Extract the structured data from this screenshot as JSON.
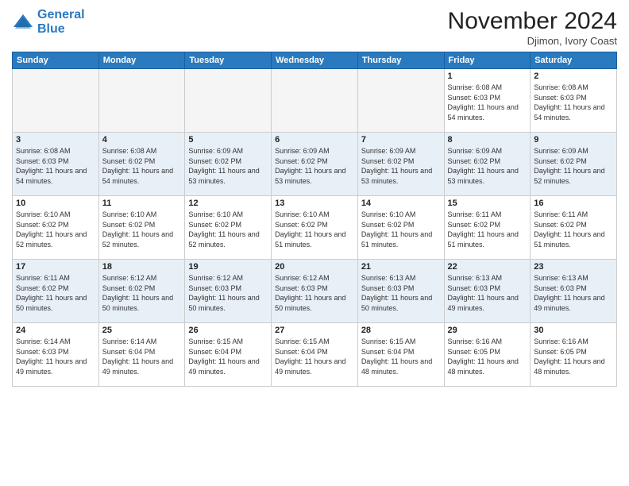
{
  "header": {
    "logo_line1": "General",
    "logo_line2": "Blue",
    "month_title": "November 2024",
    "location": "Djimon, Ivory Coast"
  },
  "weekdays": [
    "Sunday",
    "Monday",
    "Tuesday",
    "Wednesday",
    "Thursday",
    "Friday",
    "Saturday"
  ],
  "weeks": [
    [
      {
        "day": "",
        "empty": true
      },
      {
        "day": "",
        "empty": true
      },
      {
        "day": "",
        "empty": true
      },
      {
        "day": "",
        "empty": true
      },
      {
        "day": "",
        "empty": true
      },
      {
        "day": "1",
        "sunrise": "6:08 AM",
        "sunset": "6:03 PM",
        "daylight": "11 hours and 54 minutes."
      },
      {
        "day": "2",
        "sunrise": "6:08 AM",
        "sunset": "6:03 PM",
        "daylight": "11 hours and 54 minutes."
      }
    ],
    [
      {
        "day": "3",
        "sunrise": "6:08 AM",
        "sunset": "6:03 PM",
        "daylight": "11 hours and 54 minutes."
      },
      {
        "day": "4",
        "sunrise": "6:08 AM",
        "sunset": "6:02 PM",
        "daylight": "11 hours and 54 minutes."
      },
      {
        "day": "5",
        "sunrise": "6:09 AM",
        "sunset": "6:02 PM",
        "daylight": "11 hours and 53 minutes."
      },
      {
        "day": "6",
        "sunrise": "6:09 AM",
        "sunset": "6:02 PM",
        "daylight": "11 hours and 53 minutes."
      },
      {
        "day": "7",
        "sunrise": "6:09 AM",
        "sunset": "6:02 PM",
        "daylight": "11 hours and 53 minutes."
      },
      {
        "day": "8",
        "sunrise": "6:09 AM",
        "sunset": "6:02 PM",
        "daylight": "11 hours and 53 minutes."
      },
      {
        "day": "9",
        "sunrise": "6:09 AM",
        "sunset": "6:02 PM",
        "daylight": "11 hours and 52 minutes."
      }
    ],
    [
      {
        "day": "10",
        "sunrise": "6:10 AM",
        "sunset": "6:02 PM",
        "daylight": "11 hours and 52 minutes."
      },
      {
        "day": "11",
        "sunrise": "6:10 AM",
        "sunset": "6:02 PM",
        "daylight": "11 hours and 52 minutes."
      },
      {
        "day": "12",
        "sunrise": "6:10 AM",
        "sunset": "6:02 PM",
        "daylight": "11 hours and 52 minutes."
      },
      {
        "day": "13",
        "sunrise": "6:10 AM",
        "sunset": "6:02 PM",
        "daylight": "11 hours and 51 minutes."
      },
      {
        "day": "14",
        "sunrise": "6:10 AM",
        "sunset": "6:02 PM",
        "daylight": "11 hours and 51 minutes."
      },
      {
        "day": "15",
        "sunrise": "6:11 AM",
        "sunset": "6:02 PM",
        "daylight": "11 hours and 51 minutes."
      },
      {
        "day": "16",
        "sunrise": "6:11 AM",
        "sunset": "6:02 PM",
        "daylight": "11 hours and 51 minutes."
      }
    ],
    [
      {
        "day": "17",
        "sunrise": "6:11 AM",
        "sunset": "6:02 PM",
        "daylight": "11 hours and 50 minutes."
      },
      {
        "day": "18",
        "sunrise": "6:12 AM",
        "sunset": "6:02 PM",
        "daylight": "11 hours and 50 minutes."
      },
      {
        "day": "19",
        "sunrise": "6:12 AM",
        "sunset": "6:03 PM",
        "daylight": "11 hours and 50 minutes."
      },
      {
        "day": "20",
        "sunrise": "6:12 AM",
        "sunset": "6:03 PM",
        "daylight": "11 hours and 50 minutes."
      },
      {
        "day": "21",
        "sunrise": "6:13 AM",
        "sunset": "6:03 PM",
        "daylight": "11 hours and 50 minutes."
      },
      {
        "day": "22",
        "sunrise": "6:13 AM",
        "sunset": "6:03 PM",
        "daylight": "11 hours and 49 minutes."
      },
      {
        "day": "23",
        "sunrise": "6:13 AM",
        "sunset": "6:03 PM",
        "daylight": "11 hours and 49 minutes."
      }
    ],
    [
      {
        "day": "24",
        "sunrise": "6:14 AM",
        "sunset": "6:03 PM",
        "daylight": "11 hours and 49 minutes."
      },
      {
        "day": "25",
        "sunrise": "6:14 AM",
        "sunset": "6:04 PM",
        "daylight": "11 hours and 49 minutes."
      },
      {
        "day": "26",
        "sunrise": "6:15 AM",
        "sunset": "6:04 PM",
        "daylight": "11 hours and 49 minutes."
      },
      {
        "day": "27",
        "sunrise": "6:15 AM",
        "sunset": "6:04 PM",
        "daylight": "11 hours and 49 minutes."
      },
      {
        "day": "28",
        "sunrise": "6:15 AM",
        "sunset": "6:04 PM",
        "daylight": "11 hours and 48 minutes."
      },
      {
        "day": "29",
        "sunrise": "6:16 AM",
        "sunset": "6:05 PM",
        "daylight": "11 hours and 48 minutes."
      },
      {
        "day": "30",
        "sunrise": "6:16 AM",
        "sunset": "6:05 PM",
        "daylight": "11 hours and 48 minutes."
      }
    ]
  ],
  "labels": {
    "sunrise": "Sunrise:",
    "sunset": "Sunset:",
    "daylight": "Daylight:"
  }
}
